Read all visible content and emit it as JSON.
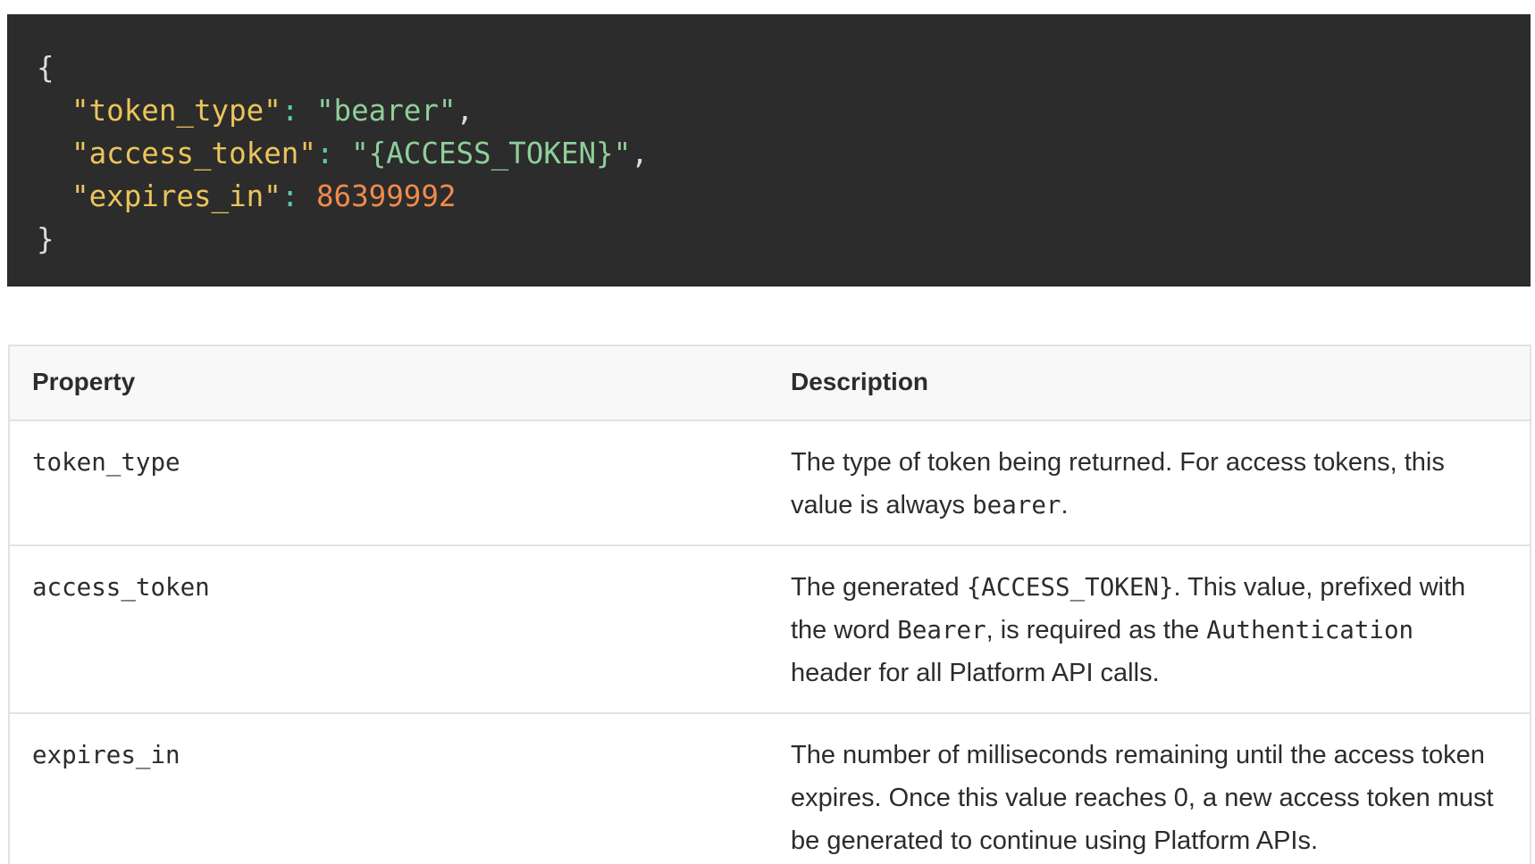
{
  "code": {
    "open_brace": "{",
    "close_brace": "}",
    "lines": [
      {
        "key": "\"token_type\"",
        "value": "\"bearer\"",
        "trail": ","
      },
      {
        "key": "\"access_token\"",
        "value": "\"{ACCESS_TOKEN}\"",
        "trail": ","
      },
      {
        "key": "\"expires_in\"",
        "value": "86399992",
        "trail": ""
      }
    ],
    "colon": ":",
    "colors": {
      "background": "#2c2c2c",
      "key": "#ecc45a",
      "string": "#8fcf9a",
      "number": "#f08a4c",
      "colon": "#5fc8b4"
    }
  },
  "table": {
    "headers": {
      "property": "Property",
      "description": "Description"
    },
    "rows": [
      {
        "property": "token_type",
        "desc": {
          "t1": "The type of token being returned. For access tokens, this value is always ",
          "c1": "bearer",
          "t2": "."
        }
      },
      {
        "property": "access_token",
        "desc": {
          "t1": "The generated ",
          "c1": "{ACCESS_TOKEN}",
          "t2": ". This value, prefixed with the word ",
          "c2": "Bearer",
          "t3": ", is required as the ",
          "c3": "Authentication",
          "t4": " header for all Platform API calls."
        }
      },
      {
        "property": "expires_in",
        "desc": {
          "t1": "The number of milliseconds remaining until the access token expires. Once this value reaches 0, a new access token must be generated to continue using Platform APIs."
        }
      }
    ]
  }
}
